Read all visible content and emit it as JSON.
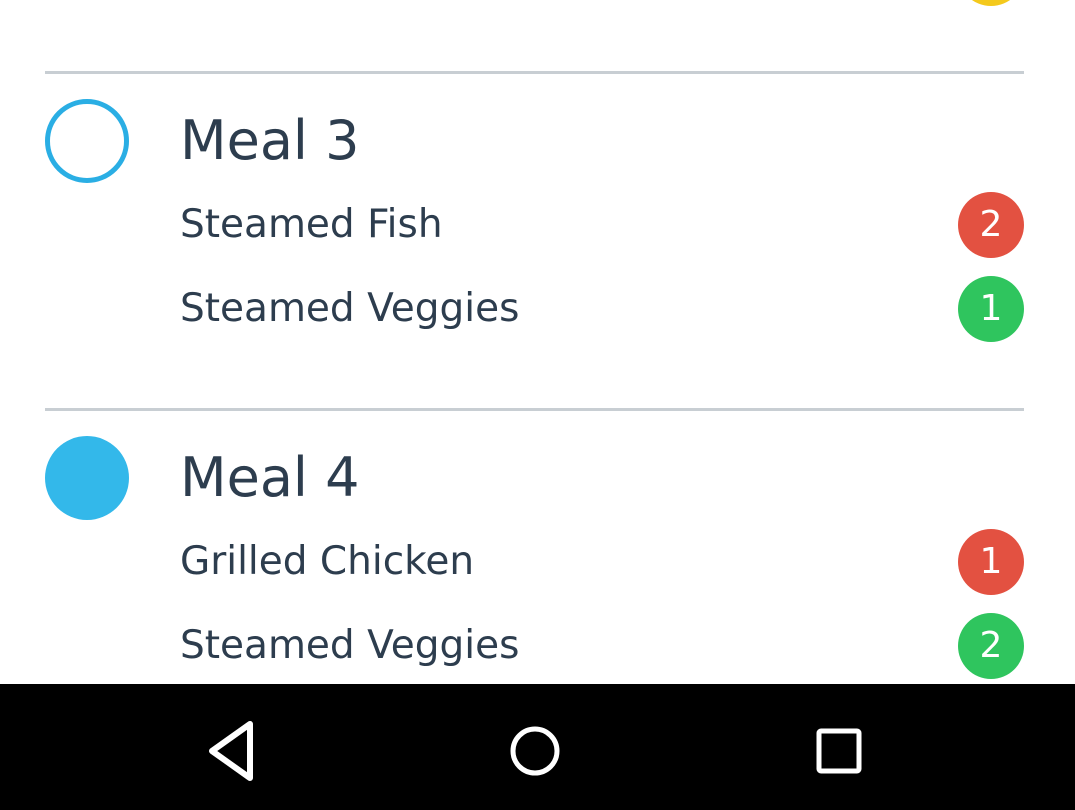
{
  "colors": {
    "status_ring": "#2aaee4",
    "status_fill": "#33b8ea",
    "badge_red": "#e35141",
    "badge_green": "#2fc55e",
    "badge_yellow": "#f4c91c",
    "divider": "#c8ced3",
    "text": "#2d3d4e",
    "nav_bg": "#000000",
    "nav_icon": "#ffffff"
  },
  "meals": [
    {
      "title": "Meal 3",
      "status": "incomplete",
      "status_icon": "empty-circle-icon",
      "items": [
        {
          "name": "Steamed Fish",
          "qty": "2",
          "badge_color": "red"
        },
        {
          "name": "Steamed Veggies",
          "qty": "1",
          "badge_color": "green"
        }
      ]
    },
    {
      "title": "Meal 4",
      "status": "complete",
      "status_icon": "filled-circle-icon",
      "items": [
        {
          "name": "Grilled Chicken",
          "qty": "1",
          "badge_color": "red"
        },
        {
          "name": "Steamed Veggies",
          "qty": "2",
          "badge_color": "green"
        }
      ]
    }
  ],
  "nav": {
    "back_icon": "back-triangle-icon",
    "home_icon": "home-circle-icon",
    "recents_icon": "recents-square-icon"
  }
}
